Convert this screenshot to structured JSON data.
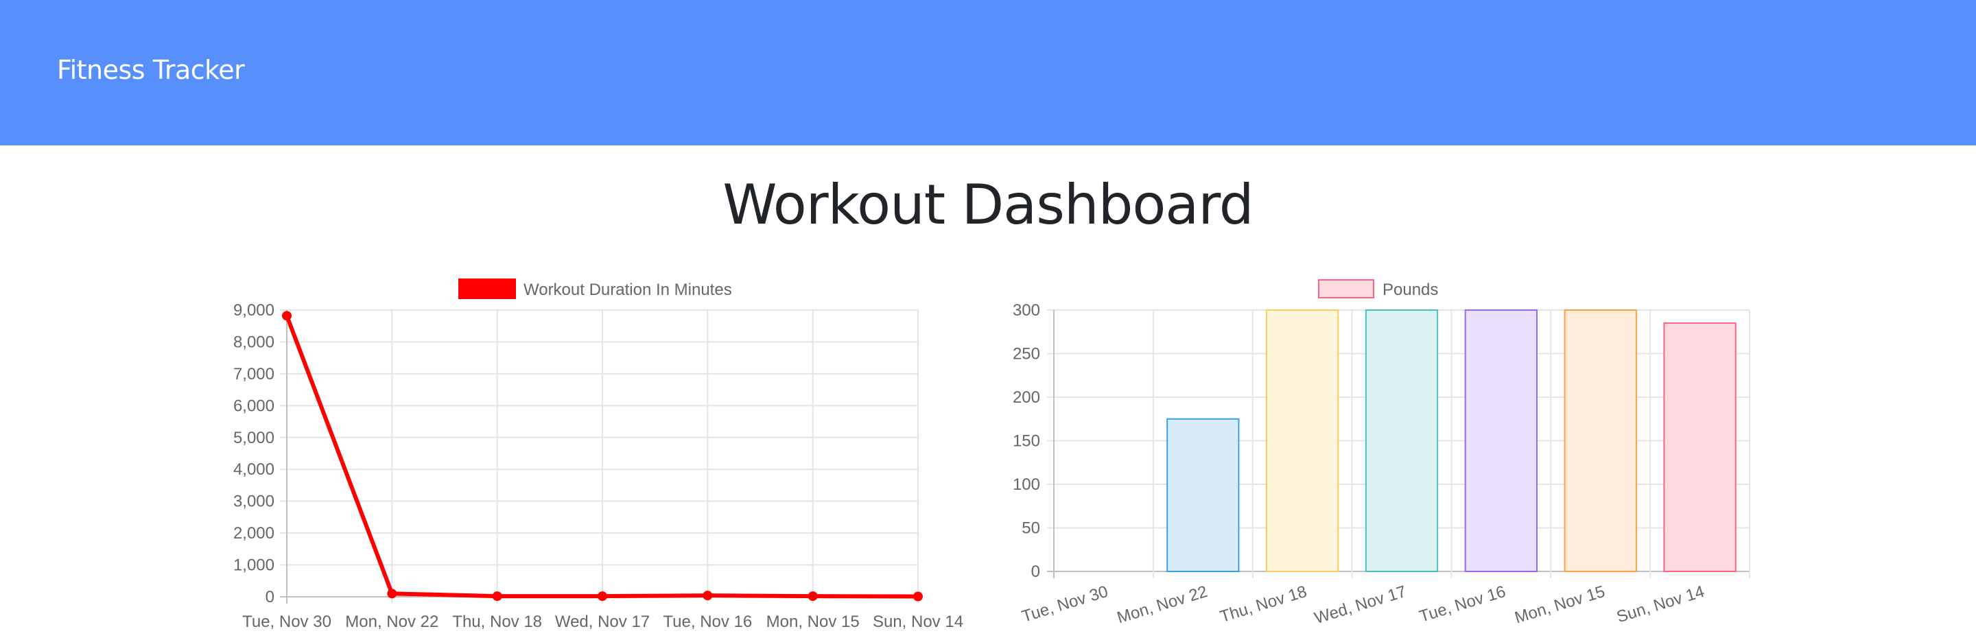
{
  "navbar": {
    "brand": "Fitness Tracker",
    "background_color": "#5790fd"
  },
  "page": {
    "title": "Workout Dashboard"
  },
  "chart_data": [
    {
      "type": "line",
      "legend": {
        "label": "Workout Duration In Minutes",
        "position": "top",
        "color": "#ff0000"
      },
      "categories": [
        "Tue, Nov 30",
        "Mon, Nov 22",
        "Thu, Nov 18",
        "Wed, Nov 17",
        "Tue, Nov 16",
        "Mon, Nov 15",
        "Sun, Nov 14"
      ],
      "series": [
        {
          "name": "Workout Duration In Minutes",
          "values": [
            8820,
            100,
            20,
            20,
            40,
            20,
            10
          ],
          "color": "#ff0000"
        }
      ],
      "yticks": [
        "0",
        "1,000",
        "2,000",
        "3,000",
        "4,000",
        "5,000",
        "6,000",
        "7,000",
        "8,000",
        "9,000"
      ],
      "ylim": [
        0,
        9000
      ],
      "grid": true
    },
    {
      "type": "bar",
      "legend": {
        "label": "Pounds",
        "position": "top",
        "color": "#ff6384"
      },
      "categories": [
        "Tue, Nov 30",
        "Mon, Nov 22",
        "Thu, Nov 18",
        "Wed, Nov 17",
        "Tue, Nov 16",
        "Mon, Nov 15",
        "Sun, Nov 14"
      ],
      "series": [
        {
          "name": "Pounds",
          "values": [
            0,
            175,
            300,
            300,
            300,
            300,
            285
          ]
        }
      ],
      "bar_colors": [
        {
          "fill": "#ffdbe2",
          "stroke": "#ff6384"
        },
        {
          "fill": "#d7ebfa",
          "stroke": "#36a2eb"
        },
        {
          "fill": "#fff5dd",
          "stroke": "#ffcd56"
        },
        {
          "fill": "#dbf2f2",
          "stroke": "#4bc0c0"
        },
        {
          "fill": "#ebe0ff",
          "stroke": "#9966ff"
        },
        {
          "fill": "#ffecd9",
          "stroke": "#ff9f40"
        },
        {
          "fill": "#ffdbe2",
          "stroke": "#ff6384"
        }
      ],
      "yticks": [
        "0",
        "50",
        "100",
        "150",
        "200",
        "250",
        "300"
      ],
      "ylim": [
        0,
        300
      ],
      "grid": true
    }
  ]
}
